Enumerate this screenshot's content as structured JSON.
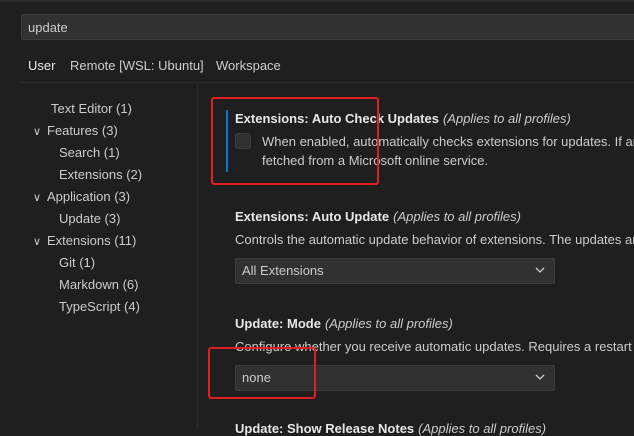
{
  "search": {
    "value": "update"
  },
  "tabs": [
    {
      "label": "User"
    },
    {
      "label": "Remote [WSL: Ubuntu]"
    },
    {
      "label": "Workspace"
    }
  ],
  "toc": [
    {
      "label": "Text Editor (1)"
    },
    {
      "label": "Features (3)"
    },
    {
      "label": "Search (1)"
    },
    {
      "label": "Extensions (2)"
    },
    {
      "label": "Application (3)"
    },
    {
      "label": "Update (3)"
    },
    {
      "label": "Extensions (11)"
    },
    {
      "label": "Git (1)"
    },
    {
      "label": "Markdown (6)"
    },
    {
      "label": "TypeScript (4)"
    }
  ],
  "settings": {
    "auto_check": {
      "category": "Extensions: ",
      "name": "Auto Check Updates",
      "scope": "(Applies to all profiles)",
      "desc_line1": "When enabled, automatically checks extensions for updates. If an",
      "desc_line2": "fetched from a Microsoft online service."
    },
    "auto_update": {
      "category": "Extensions: ",
      "name": "Auto Update",
      "scope": "(Applies to all profiles)",
      "desc": "Controls the automatic update behavior of extensions. The updates ar",
      "value": "All Extensions"
    },
    "update_mode": {
      "category": "Update: ",
      "name": "Mode",
      "scope": "(Applies to all profiles)",
      "desc": "Configure whether you receive automatic updates. Requires a restart a",
      "value": "none"
    },
    "release_notes": {
      "category": "Update: ",
      "name": "Show Release Notes",
      "scope": "(Applies to all profiles)"
    }
  },
  "colors": {
    "accent": "#0078d4",
    "highlight_box": "#e02020",
    "background": "#1f1f1f"
  }
}
